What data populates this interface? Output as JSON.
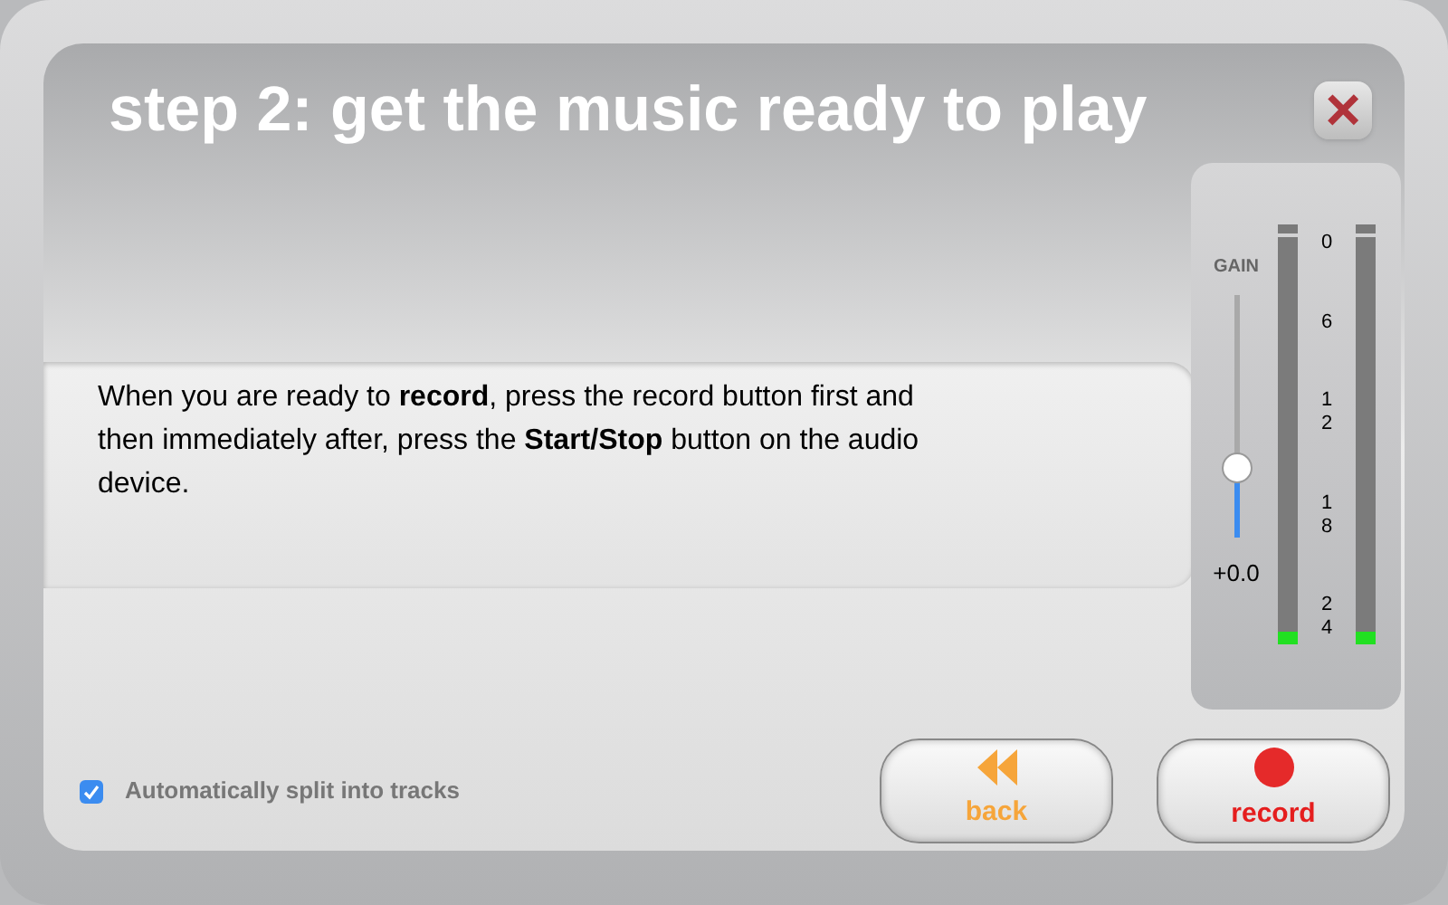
{
  "title": "step 2: get the music ready to play",
  "close": {
    "label": "×"
  },
  "instructions": "When you are ready to **record**, press the record button first and then immediately after, press the **Start/Stop** button on the audio device.",
  "gain": {
    "label": "GAIN",
    "level": 0.28,
    "reading": "+0.0"
  },
  "meters": [
    {
      "level": 0.03
    },
    {
      "level": 0.03
    }
  ],
  "scale": [
    "0",
    "6",
    "12",
    "18",
    "24"
  ],
  "auto_split": {
    "label": "Automatically split into tracks",
    "checked": true
  },
  "buttons": [
    {
      "kind": "back",
      "label": "back"
    },
    {
      "kind": "record",
      "label": "record"
    }
  ]
}
